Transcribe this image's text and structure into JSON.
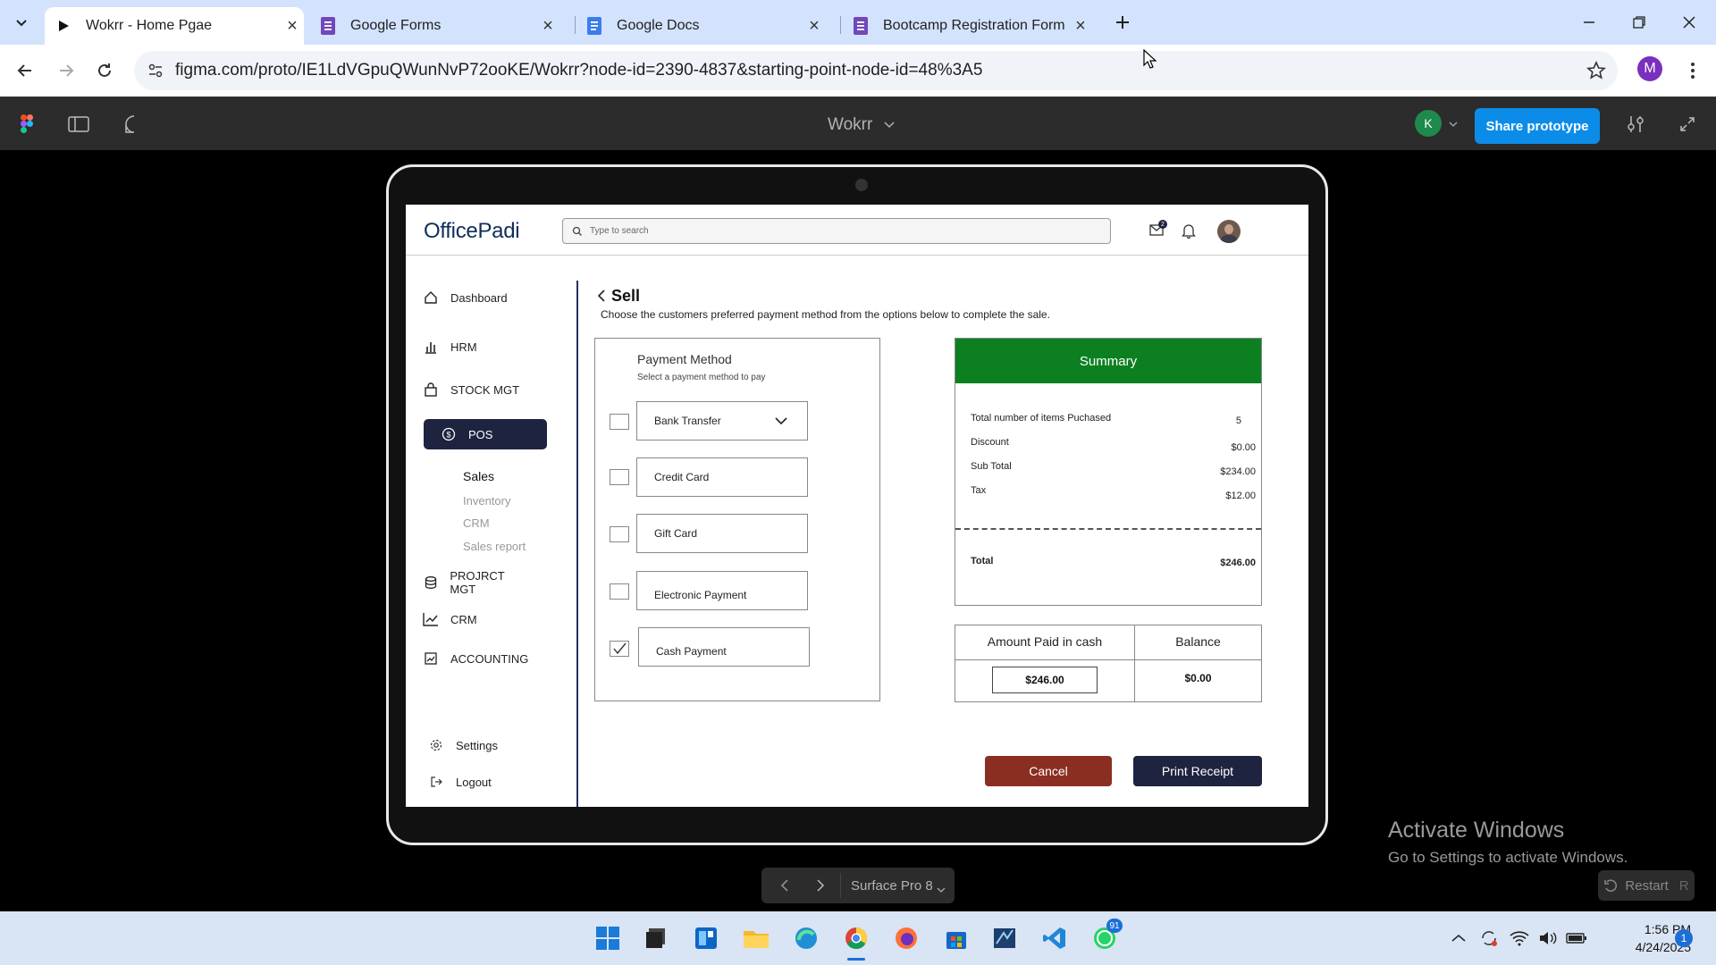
{
  "browser": {
    "tabs": [
      {
        "title": "Wokrr - Home Pgae",
        "active": true
      },
      {
        "title": "Google Forms"
      },
      {
        "title": "Google Docs"
      },
      {
        "title": "Bootcamp Registration Form - G"
      }
    ],
    "url": "figma.com/proto/IE1LdVGpuQWunNvP72ooKE/Wokrr?node-id=2390-4837&starting-point-node-id=48%3A5",
    "profile_initial": "M"
  },
  "figma": {
    "project_name": "Wokrr",
    "user_initial": "K",
    "share_label": "Share prototype",
    "device_name": "Surface Pro 8",
    "restart_label": "Restart",
    "restart_key": "R"
  },
  "app": {
    "logo_prefix": "O",
    "logo_text": "fficePadi",
    "search_placeholder": "Type to search",
    "mail_badge": "2",
    "sidebar": {
      "dashboard": "Dashboard",
      "hrm": "HRM",
      "stock": "STOCK MGT",
      "pos": "POS",
      "sub": [
        "Sales",
        "Inventory",
        "CRM",
        "Sales report"
      ],
      "project": "PROJRCT MGT",
      "crm": "CRM",
      "accounting": "ACCOUNTING",
      "settings": "Settings",
      "logout": "Logout"
    },
    "sell": {
      "title": "Sell",
      "description": "Choose the customers preferred payment method from the options below to complete the sale."
    },
    "payment": {
      "title": "Payment Method",
      "subtitle": "Select a payment method to pay",
      "options": [
        "Bank Transfer",
        "Credit Card",
        "Gift Card",
        "Electronic Payment",
        "Cash Payment"
      ],
      "selected": "Cash Payment"
    },
    "summary": {
      "title": "Summary",
      "items_label": "Total number of items Puchased",
      "items_value": "5",
      "discount_label": "Discount",
      "discount_value": "$0.00",
      "subtotal_label": "Sub Total",
      "subtotal_value": "$234.00",
      "tax_label": "Tax",
      "tax_value": "$12.00",
      "total_label": "Total",
      "total_value": "$246.00"
    },
    "cash": {
      "amount_label": "Amount Paid in cash",
      "balance_label": "Balance",
      "amount_value": "$246.00",
      "balance_value": "$0.00"
    },
    "actions": {
      "cancel": "Cancel",
      "print": "Print Receipt"
    }
  },
  "windows": {
    "activate_title": "Activate Windows",
    "activate_sub": "Go to Settings to activate Windows.",
    "whatsapp_badge": "91",
    "time": "1:56 PM",
    "date": "4/24/2025",
    "notif_count": "1"
  },
  "colors": {
    "accent_green": "#0c8020",
    "navy": "#1e2340",
    "cancel_red": "#8b2e22",
    "figma_blue": "#0c8ce9"
  }
}
